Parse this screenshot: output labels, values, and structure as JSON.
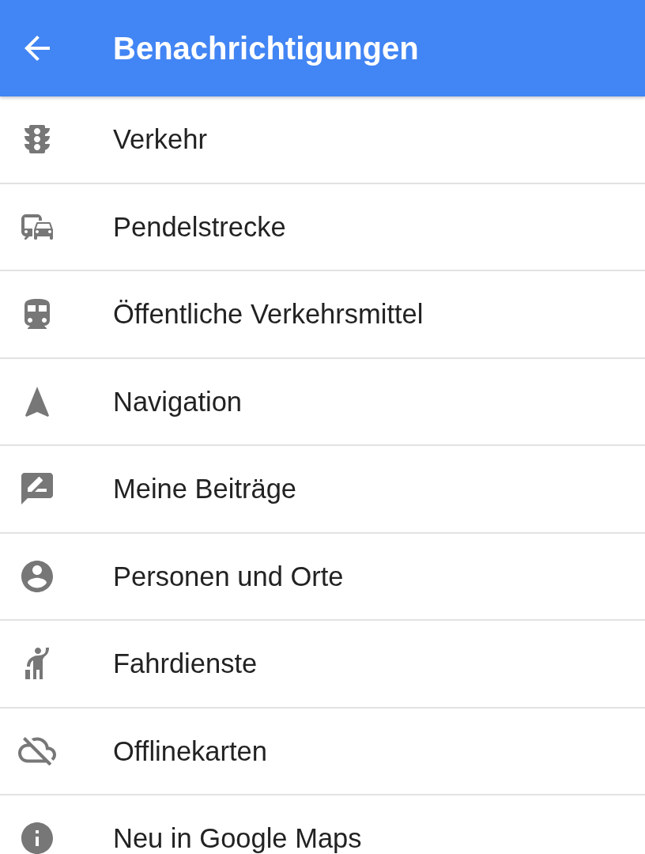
{
  "header": {
    "title": "Benachrichtigungen"
  },
  "items": [
    {
      "label": "Verkehr",
      "kind": "traffic"
    },
    {
      "label": "Pendelstrecke",
      "kind": "commute"
    },
    {
      "label": "Öffentliche Verkehrsmittel",
      "kind": "transit"
    },
    {
      "label": "Navigation",
      "kind": "navigation"
    },
    {
      "label": "Meine Beiträge",
      "kind": "contributions"
    },
    {
      "label": "Personen und Orte",
      "kind": "people"
    },
    {
      "label": "Fahrdienste",
      "kind": "rides"
    },
    {
      "label": "Offlinekarten",
      "kind": "offline"
    },
    {
      "label": "Neu in Google Maps",
      "kind": "news"
    }
  ]
}
